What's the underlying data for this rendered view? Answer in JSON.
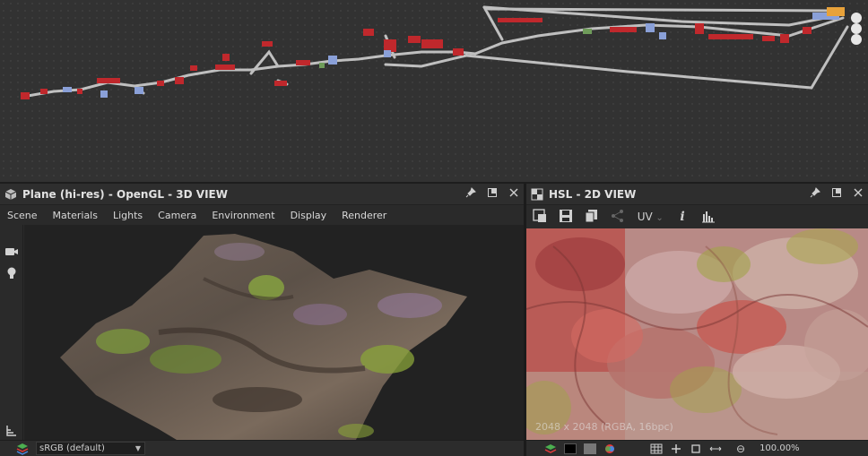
{
  "viewport3d": {
    "title": "Plane (hi-res) - OpenGL - 3D VIEW",
    "menu": [
      "Scene",
      "Materials",
      "Lights",
      "Camera",
      "Environment",
      "Display",
      "Renderer"
    ],
    "colorspace": "sRGB (default)",
    "side_tools": [
      "camera-icon",
      "light-bulb-icon",
      "stats-icon"
    ]
  },
  "viewport2d": {
    "title": "HSL - 2D VIEW",
    "uv_label": "UV",
    "image_info": "2048 x 2048 (RGBA, 16bpc)",
    "zoom": "100.00%"
  },
  "header_tools": [
    "pin-icon",
    "maximize-icon",
    "close-icon"
  ],
  "colors": {
    "panel": "#2a2a2a",
    "graph_bg": "#323232",
    "node_red": "#c0282c",
    "node_white": "#d8d8d8",
    "accent_orange": "#e8a23a"
  }
}
